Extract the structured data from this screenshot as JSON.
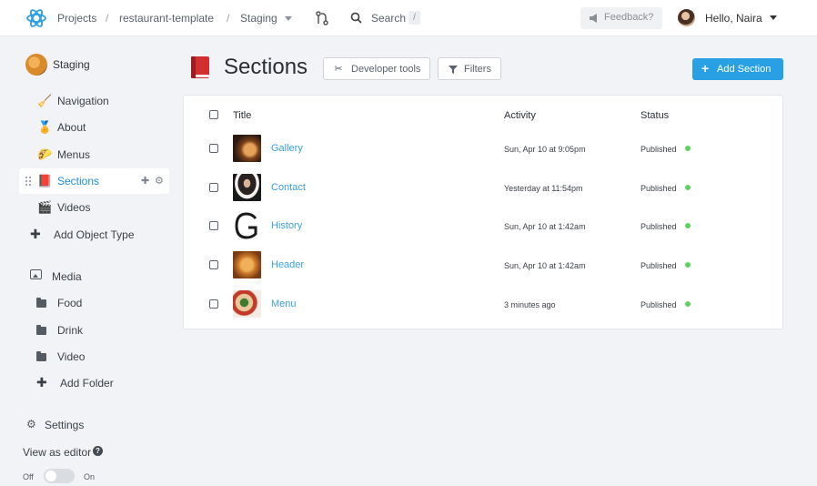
{
  "header": {
    "breadcrumbs": [
      "Projects",
      "restaurant-template",
      "Staging"
    ],
    "separator": "/",
    "search_label": "Search",
    "search_shortcut": "/",
    "feedback_label": "Feedback?",
    "user_greeting": "Hello, Naira"
  },
  "sidebar": {
    "workspace": "Staging",
    "object_types": [
      {
        "label": "Navigation",
        "icon": "broom-icon"
      },
      {
        "label": "About",
        "icon": "medal-icon"
      },
      {
        "label": "Menus",
        "icon": "taco-icon"
      },
      {
        "label": "Sections",
        "icon": "book-icon",
        "active": true
      },
      {
        "label": "Videos",
        "icon": "clapperboard-icon"
      }
    ],
    "add_object_type": "Add Object Type",
    "media_label": "Media",
    "folders": [
      "Food",
      "Drink",
      "Video"
    ],
    "add_folder": "Add Folder",
    "settings_label": "Settings",
    "view_as_editor": "View as editor",
    "toggle_off": "Off",
    "toggle_on": "On",
    "toggle_state": false
  },
  "main": {
    "title": "Sections",
    "developer_tools": "Developer tools",
    "filters": "Filters",
    "add_section": "Add Section",
    "columns": {
      "title": "Title",
      "activity": "Activity",
      "status": "Status"
    },
    "rows": [
      {
        "title": "Gallery",
        "activity": "Sun, Apr 10 at 9:05pm",
        "status": "Published",
        "thumb": "gallery"
      },
      {
        "title": "Contact",
        "activity": "Yesterday at 11:54pm",
        "status": "Published",
        "thumb": "contact"
      },
      {
        "title": "History",
        "activity": "Sun, Apr 10 at 1:42am",
        "status": "Published",
        "thumb": "history"
      },
      {
        "title": "Header",
        "activity": "Sun, Apr 10 at 1:42am",
        "status": "Published",
        "thumb": "header"
      },
      {
        "title": "Menu",
        "activity": "3 minutes ago",
        "status": "Published",
        "thumb": "menu"
      }
    ]
  },
  "colors": {
    "accent": "#29a0e3",
    "link": "#3aa0e0",
    "published_dot": "#5fd35f",
    "background": "#f2f3f6"
  }
}
